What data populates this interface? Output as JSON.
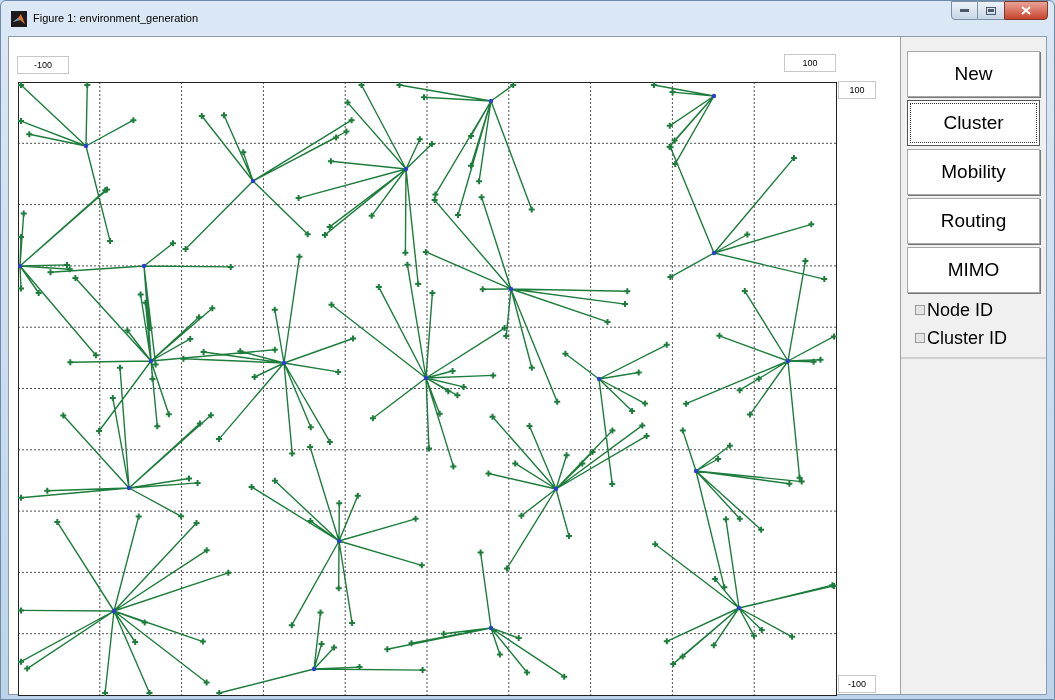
{
  "window": {
    "title": "Figure 1: environment_generation"
  },
  "limit_boxes": [
    {
      "kind": "x_min",
      "value": "-100"
    },
    {
      "kind": "x_max",
      "value": "100"
    },
    {
      "kind": "y_max",
      "value": "100"
    },
    {
      "kind": "y_min",
      "value": "-100"
    }
  ],
  "buttons": [
    {
      "label": "New",
      "selected": false
    },
    {
      "label": "Cluster",
      "selected": true
    },
    {
      "label": "Mobility",
      "selected": false
    },
    {
      "label": "Routing",
      "selected": false
    },
    {
      "label": "MIMO",
      "selected": false
    }
  ],
  "checkboxes": [
    {
      "label": "Node ID",
      "checked": false
    },
    {
      "label": "Cluster ID",
      "checked": false
    }
  ]
}
